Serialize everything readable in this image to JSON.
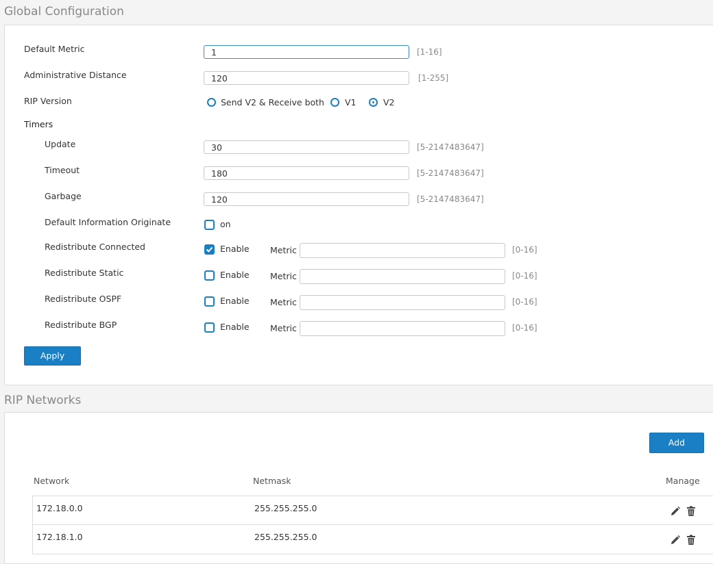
{
  "global": {
    "title": "Global Configuration",
    "default_metric": {
      "label": "Default Metric",
      "value": "1",
      "range": "[1-16]"
    },
    "admin_distance": {
      "label": "Administrative Distance",
      "value": "120",
      "range": "[1-255]"
    },
    "rip_version": {
      "label": "RIP Version",
      "options": [
        "Send V2 & Receive both",
        "V1",
        "V2"
      ],
      "selected": "V2"
    },
    "timers": {
      "label": "Timers",
      "update": {
        "label": "Update",
        "value": "30",
        "range": "[5-2147483647]"
      },
      "timeout": {
        "label": "Timeout",
        "value": "180",
        "range": "[5-2147483647]"
      },
      "garbage": {
        "label": "Garbage",
        "value": "120",
        "range": "[5-2147483647]"
      }
    },
    "default_info_originate": {
      "label": "Default Information Originate",
      "checkbox_label": "on",
      "checked": false
    },
    "redistribute": [
      {
        "label": "Redistribute Connected",
        "enable_label": "Enable",
        "checked": true,
        "metric_label": "Metric",
        "metric_value": "",
        "range": "[0-16]"
      },
      {
        "label": "Redistribute Static",
        "enable_label": "Enable",
        "checked": false,
        "metric_label": "Metric",
        "metric_value": "",
        "range": "[0-16]"
      },
      {
        "label": "Redistribute OSPF",
        "enable_label": "Enable",
        "checked": false,
        "metric_label": "Metric",
        "metric_value": "",
        "range": "[0-16]"
      },
      {
        "label": "Redistribute BGP",
        "enable_label": "Enable",
        "checked": false,
        "metric_label": "Metric",
        "metric_value": "",
        "range": "[0-16]"
      }
    ],
    "apply_label": "Apply"
  },
  "networks": {
    "title": "RIP Networks",
    "add_label": "Add",
    "columns": [
      "Network",
      "Netmask",
      "Manage"
    ],
    "rows": [
      {
        "network": "172.18.0.0",
        "netmask": "255.255.255.0"
      },
      {
        "network": "172.18.1.0",
        "netmask": "255.255.255.0"
      }
    ]
  },
  "colors": {
    "accent": "#1a7fc4",
    "title": "#888888",
    "border": "#dcdcdc"
  }
}
